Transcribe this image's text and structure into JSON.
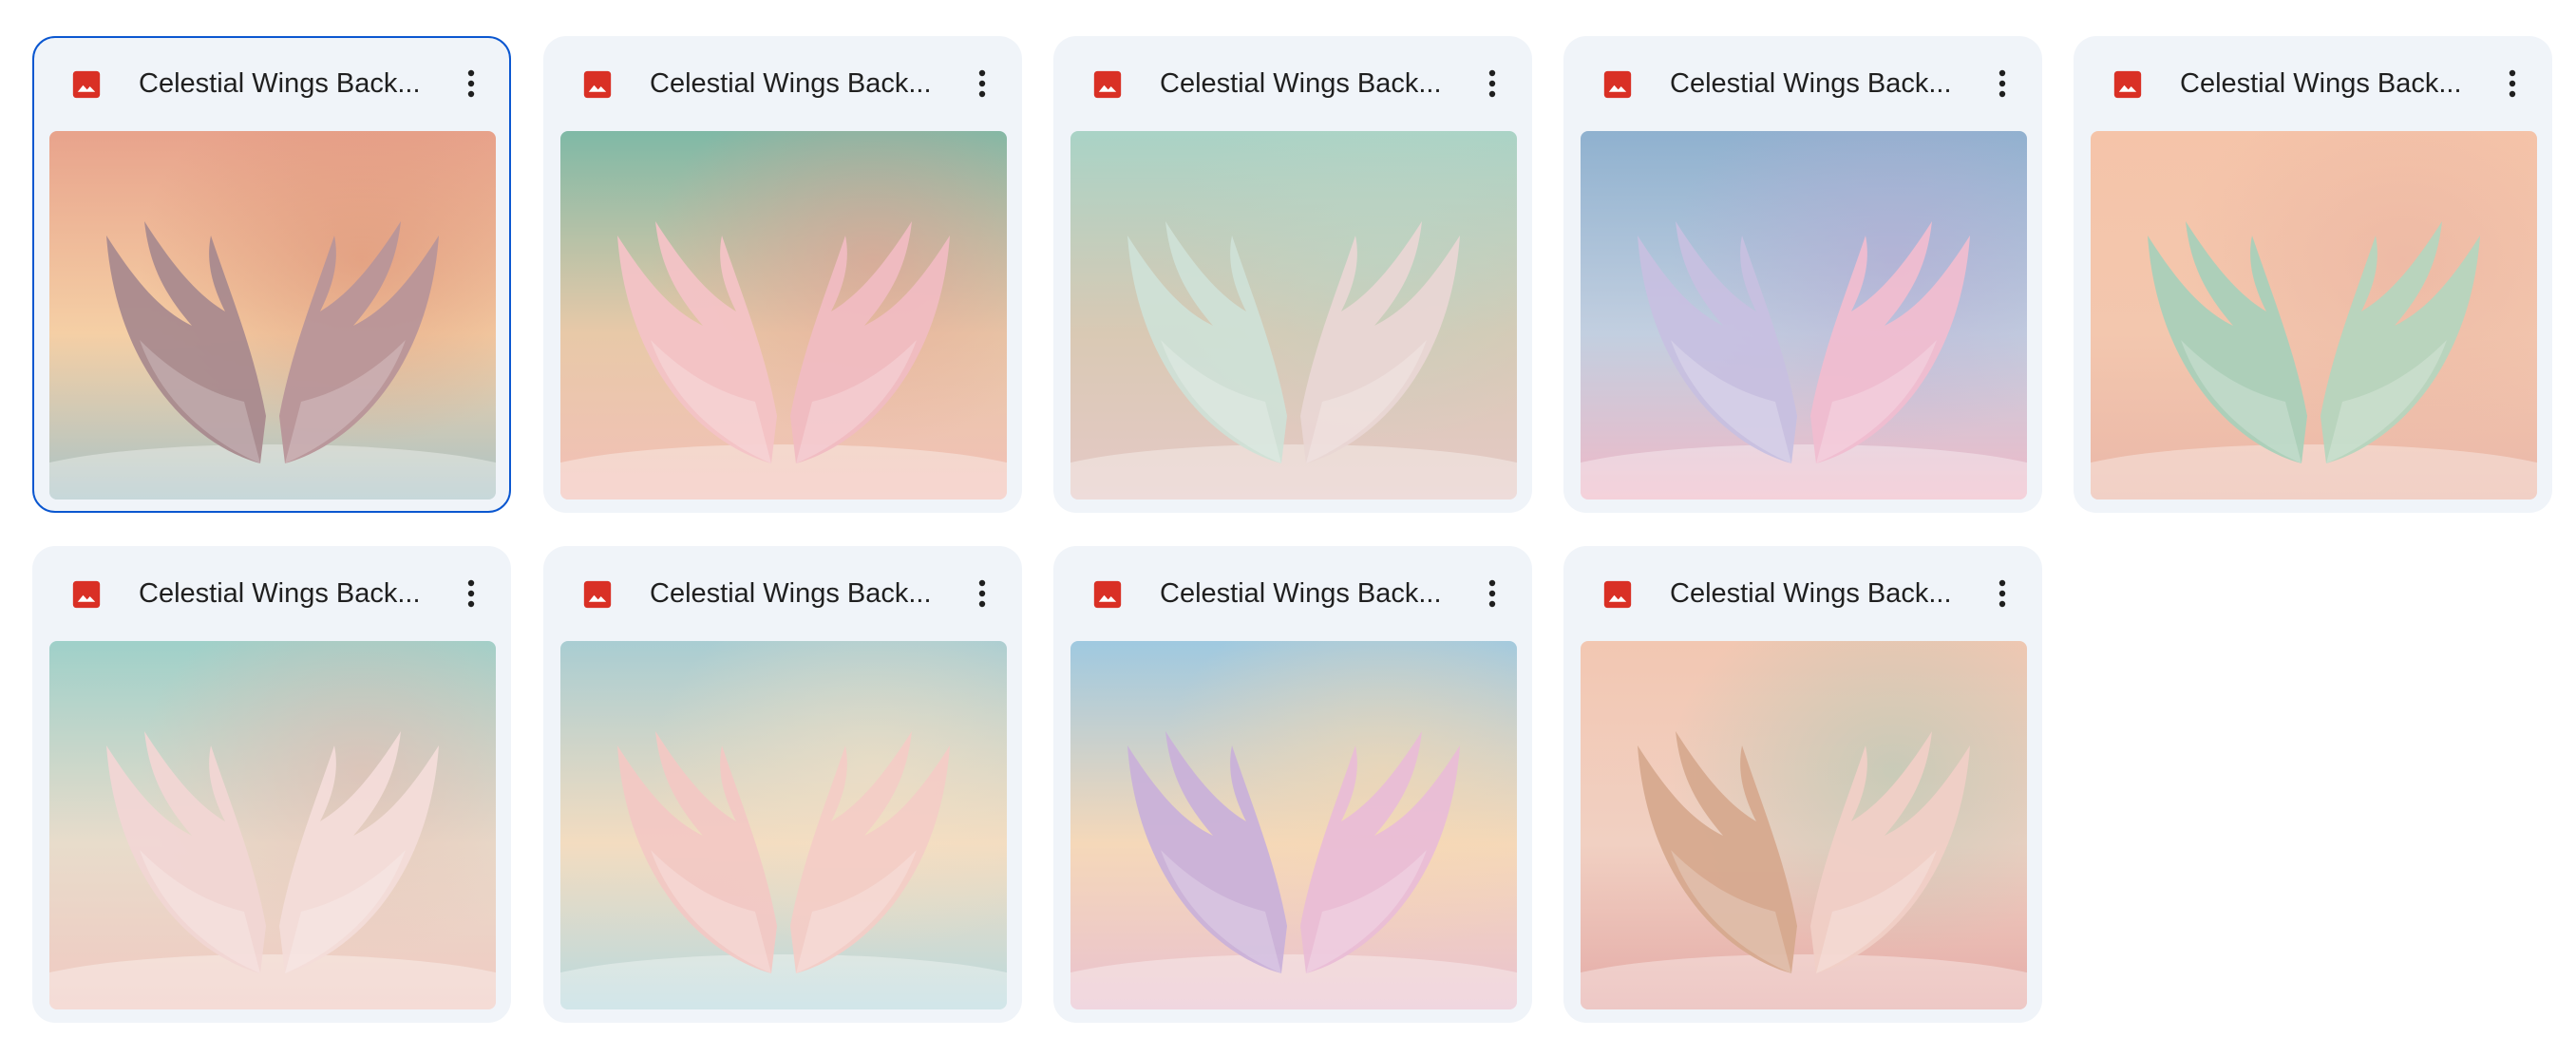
{
  "files": [
    {
      "name": "Celestial Wings Back...",
      "type_icon": "image-file-icon",
      "selected": true,
      "palette": {
        "top": "#e8a38c",
        "mid": "#f5cfa5",
        "bottom": "#a9c3c6",
        "wing_left": "#a98a8e",
        "wing_right": "#b89599",
        "accent": "#d98b70"
      }
    },
    {
      "name": "Celestial Wings Back...",
      "type_icon": "image-file-icon",
      "selected": false,
      "palette": {
        "top": "#7fb9a6",
        "mid": "#e8c9a8",
        "bottom": "#f2c0b7",
        "wing_left": "#f3c3c6",
        "wing_right": "#f0bcc2",
        "accent": "#e79a8f"
      }
    },
    {
      "name": "Celestial Wings Back...",
      "type_icon": "image-file-icon",
      "selected": false,
      "palette": {
        "top": "#a9d3c6",
        "mid": "#d9c9b4",
        "bottom": "#e5c9c6",
        "wing_left": "#cfe0d6",
        "wing_right": "#e9d6d4",
        "accent": "#b9d6c6"
      }
    },
    {
      "name": "Celestial Wings Back...",
      "type_icon": "image-file-icon",
      "selected": false,
      "palette": {
        "top": "#8fb1cf",
        "mid": "#c2cfe0",
        "bottom": "#efb9c7",
        "wing_left": "#c7c0e0",
        "wing_right": "#f0bdd0",
        "accent": "#b6a7d3"
      }
    },
    {
      "name": "Celestial Wings Back...",
      "type_icon": "image-file-icon",
      "selected": false,
      "palette": {
        "top": "#f5c4a9",
        "mid": "#f3c7ae",
        "bottom": "#eab7a8",
        "wing_left": "#a9d0b9",
        "wing_right": "#b5d5be",
        "accent": "#e9b1a0"
      }
    },
    {
      "name": "Celestial Wings Back...",
      "type_icon": "image-file-icon",
      "selected": false,
      "palette": {
        "top": "#9fd0c9",
        "mid": "#e8dccb",
        "bottom": "#f0c9c1",
        "wing_left": "#f1d6d4",
        "wing_right": "#f3dcd9",
        "accent": "#e7b6ad"
      }
    },
    {
      "name": "Celestial Wings Back...",
      "type_icon": "image-file-icon",
      "selected": false,
      "palette": {
        "top": "#a9cdd2",
        "mid": "#f3dcc0",
        "bottom": "#b9d9de",
        "wing_left": "#f2c8c4",
        "wing_right": "#f3ccc6",
        "accent": "#f6e1c5"
      }
    },
    {
      "name": "Celestial Wings Back...",
      "type_icon": "image-file-icon",
      "selected": false,
      "palette": {
        "top": "#9fc9e0",
        "mid": "#f5d8b9",
        "bottom": "#e9c1cf",
        "wing_left": "#c9b1d9",
        "wing_right": "#e9bdd6",
        "accent": "#f7d9b0"
      }
    },
    {
      "name": "Celestial Wings Back...",
      "type_icon": "image-file-icon",
      "selected": false,
      "palette": {
        "top": "#f2c7b2",
        "mid": "#f1d0c2",
        "bottom": "#e4aba7",
        "wing_left": "#d6a98e",
        "wing_right": "#f0cfc6",
        "accent": "#a8c9b4"
      }
    }
  ],
  "more_icon": "more-vertical-icon",
  "accent_color": "#0b57d0",
  "file_icon_color": "#d93025"
}
